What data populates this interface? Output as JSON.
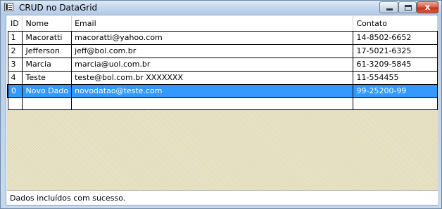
{
  "window": {
    "title": "CRUD no DataGrid",
    "close_glyph": "x"
  },
  "grid": {
    "columns": [
      "ID",
      "Nome",
      "Email",
      "Contato"
    ],
    "rows": [
      {
        "id": "1",
        "nome": "Macoratti",
        "email": "macoratti@yahoo.com",
        "contato": "14-8502-6652",
        "selected": false
      },
      {
        "id": "2",
        "nome": "Jefferson",
        "email": "jeff@bol.com.br",
        "contato": "17-5021-6325",
        "selected": false
      },
      {
        "id": "3",
        "nome": "Marcia",
        "email": "marcia@uol.com.br",
        "contato": "61-3209-5845",
        "selected": false
      },
      {
        "id": "4",
        "nome": "Teste",
        "email": "teste@bol.com.br XXXXXXX",
        "contato": "11-554455",
        "selected": false
      },
      {
        "id": "0",
        "nome": "Novo Dado",
        "email": "novodatao@teste.com",
        "contato": "99-25200-99",
        "selected": true
      }
    ],
    "selection_color": "#3399ff"
  },
  "status": {
    "message": "Dados incluídos com sucesso."
  }
}
